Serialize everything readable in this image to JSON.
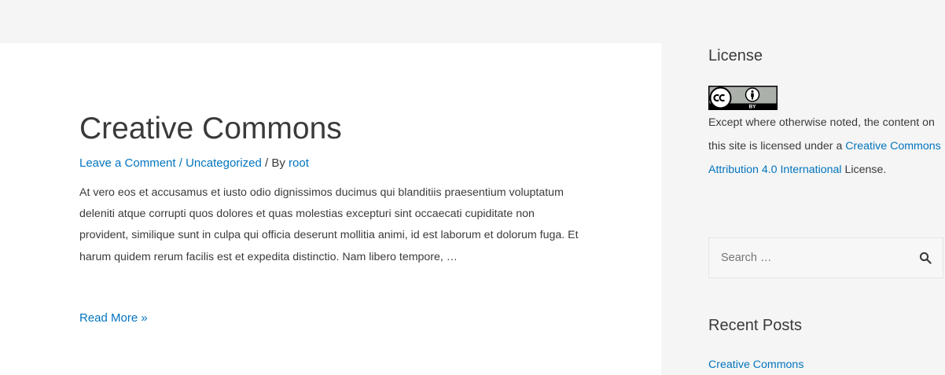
{
  "post": {
    "title": "Creative Commons",
    "meta": {
      "comment_link": "Leave a Comment",
      "separator": " / ",
      "category": "Uncategorized",
      "by_prefix": " / By ",
      "author": "root"
    },
    "excerpt": "At vero eos et accusamus et iusto odio dignissimos ducimus qui blanditiis praesentium voluptatum deleniti atque corrupti quos dolores et quas molestias excepturi sint occaecati cupiditate non provident, similique sunt in culpa qui officia deserunt mollitia animi, id est laborum et dolorum fuga. Et harum quidem rerum facilis est et expedita distinctio. Nam libero tempore, …",
    "read_more": "Read More »"
  },
  "sidebar": {
    "license": {
      "title": "License",
      "badge_icon": "cc-by-icon",
      "badge_text": "BY",
      "text_before": "Except where otherwise noted, the content on this site is licensed under a ",
      "link_text": "Creative Commons Attribution 4.0 International",
      "text_after": " License."
    },
    "search": {
      "placeholder": "Search …",
      "icon": "search-icon"
    },
    "recent_posts": {
      "title": "Recent Posts",
      "items": [
        {
          "label": "Creative Commons"
        }
      ]
    }
  },
  "colors": {
    "link": "#0274be",
    "text": "#3a3a3a",
    "background": "#f5f5f5",
    "card": "#ffffff"
  }
}
